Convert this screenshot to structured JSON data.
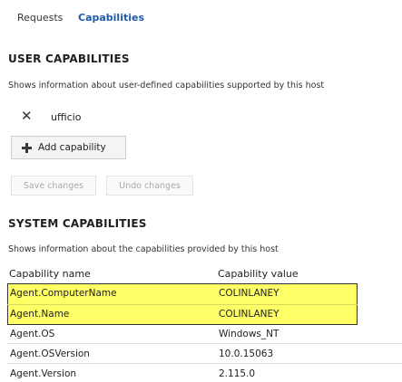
{
  "tabs": [
    {
      "label": "Requests"
    },
    {
      "label": "Capabilities"
    }
  ],
  "user_capabilities": {
    "heading": "USER CAPABILITIES",
    "description": "Shows information about user-defined capabilities supported by this host",
    "entry": {
      "value": "ufficio"
    },
    "add_label": "Add capability",
    "save_label": "Save changes",
    "undo_label": "Undo changes"
  },
  "system_capabilities": {
    "heading": "SYSTEM CAPABILITIES",
    "description": "Shows information about the capabilities provided by this host",
    "columns": [
      "Capability name",
      "Capability value"
    ],
    "rows": [
      {
        "name": "Agent.ComputerName",
        "value": "COLINLANEY",
        "highlighted": true
      },
      {
        "name": "Agent.Name",
        "value": "COLINLANEY",
        "highlighted": true
      },
      {
        "name": "Agent.OS",
        "value": "Windows_NT",
        "highlighted": false
      },
      {
        "name": "Agent.OSVersion",
        "value": "10.0.15063",
        "highlighted": false
      },
      {
        "name": "Agent.Version",
        "value": "2.115.0",
        "highlighted": false
      }
    ]
  },
  "colors": {
    "accent": "#1e5aa8",
    "highlight": "#ffff66"
  }
}
